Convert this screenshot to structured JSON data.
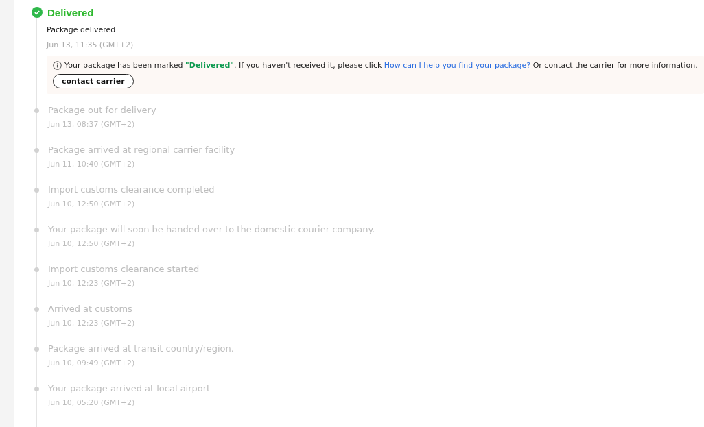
{
  "status": {
    "title": "Delivered",
    "event": "Package delivered",
    "time": "Jun 13, 11:35 (GMT+2)"
  },
  "notice": {
    "text": "Your package has been marked **\"Delivered\"**. If you haven't received it, please click",
    "link": "How can I help you find your package?",
    "after": "Or contact the carrier for more information.",
    "button": "contact carrier"
  },
  "events": [
    {
      "title": "Package out for delivery",
      "time": "Jun 13, 08:37 (GMT+2)"
    },
    {
      "title": "Package arrived at regional carrier facility",
      "time": "Jun 11, 10:40 (GMT+2)"
    },
    {
      "title": "Import customs clearance completed",
      "time": "Jun 10, 12:50 (GMT+2)"
    },
    {
      "title": "Your package will soon be handed over to the domestic courier company.",
      "time": "Jun 10, 12:50 (GMT+2)"
    },
    {
      "title": "Import customs clearance started",
      "time": "Jun 10, 12:23 (GMT+2)"
    },
    {
      "title": "Arrived at customs",
      "time": "Jun 10, 12:23 (GMT+2)"
    },
    {
      "title": "Package arrived at transit country/region.",
      "time": "Jun 10, 09:49 (GMT+2)"
    },
    {
      "title": "Your package arrived at local airport",
      "time": "Jun 10, 05:20 (GMT+2)"
    }
  ]
}
